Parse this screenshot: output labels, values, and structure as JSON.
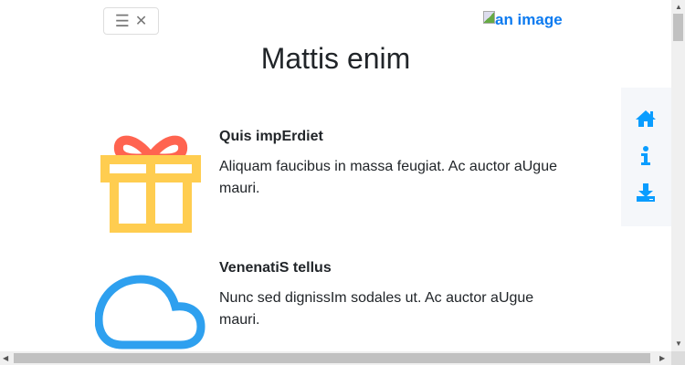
{
  "header": {
    "menu_icon": "hamburger-icon",
    "close_icon": "close-icon",
    "logo_alt": "an image"
  },
  "title": "Mattis enim",
  "features": [
    {
      "icon": "gift-icon",
      "title": "Quis impErdiet",
      "text": "Aliquam faucibus in massa feugiat. Ac auctor aUgue mauri."
    },
    {
      "icon": "cloud-icon",
      "title": "VenenatiS tellus",
      "text": "Nunc sed dignissIm sodales ut. Ac auctor aUgue mauri."
    }
  ],
  "sidebar": {
    "icons": [
      "home-icon",
      "info-icon",
      "download-icon"
    ]
  },
  "colors": {
    "accent": "#0d7bf0",
    "sidebar_icon": "#0a9dff",
    "gift_box": "#ffcd50",
    "gift_bow": "#ff6450",
    "cloud": "#2ea0ef"
  }
}
